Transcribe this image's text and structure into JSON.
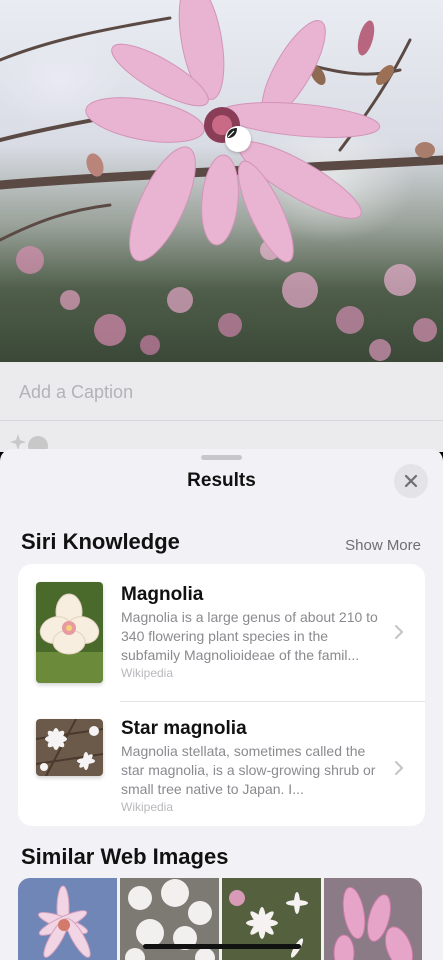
{
  "photo": {
    "description_icon": "leaf-lookup-icon"
  },
  "caption": {
    "placeholder": "Add a Caption"
  },
  "sheet": {
    "title": "Results",
    "close_icon": "close-icon"
  },
  "siri_knowledge": {
    "heading": "Siri Knowledge",
    "show_more": "Show More",
    "items": [
      {
        "title": "Magnolia",
        "description": "Magnolia is a large genus of about 210 to 340 flowering plant species in the subfamily Magnolioideae of the famil...",
        "source": "Wikipedia"
      },
      {
        "title": "Star magnolia",
        "description": "Magnolia stellata, sometimes called the star magnolia, is a slow-growing shrub or small tree native to Japan. I...",
        "source": "Wikipedia"
      }
    ]
  },
  "similar_web_images": {
    "heading": "Similar Web Images"
  },
  "colors": {
    "sheet_bg": "#f2f2f6",
    "card_bg": "#ffffff",
    "secondary_text": "#8a8a8f"
  }
}
